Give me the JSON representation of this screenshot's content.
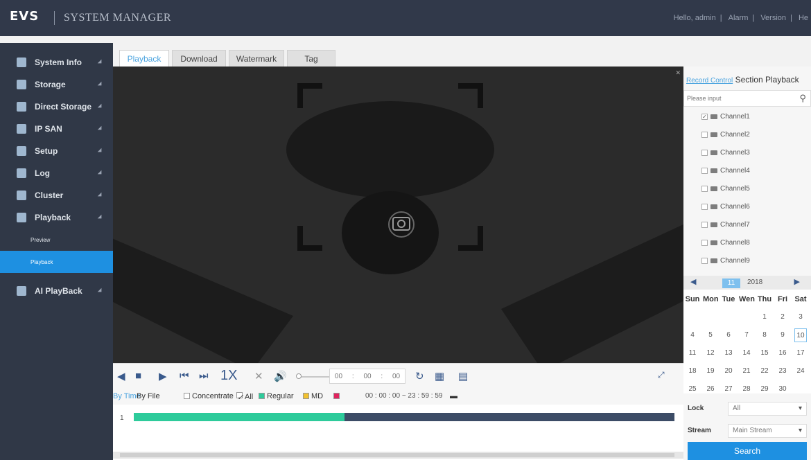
{
  "header": {
    "logo": "EVS",
    "title": "SYSTEM MANAGER",
    "links": [
      "Hello, admin",
      "Alarm",
      "Version",
      "He"
    ]
  },
  "sidebar": {
    "items": [
      {
        "label": "System Info"
      },
      {
        "label": "Storage"
      },
      {
        "label": "Direct Storage"
      },
      {
        "label": "IP SAN"
      },
      {
        "label": "Setup"
      },
      {
        "label": "Log"
      },
      {
        "label": "Cluster"
      },
      {
        "label": "Playback"
      }
    ],
    "sub_items": [
      {
        "label": "Preview"
      },
      {
        "label": "Playback"
      }
    ],
    "last_item": {
      "label": "AI PlayBack"
    }
  },
  "tabs": [
    {
      "label": "Playback"
    },
    {
      "label": "Download"
    },
    {
      "label": "Watermark"
    },
    {
      "label": "Tag"
    }
  ],
  "player": {
    "speed": "1X",
    "time": [
      "00",
      "00",
      "00"
    ]
  },
  "timebar": {
    "by_time": "By Time",
    "by_file": "By File",
    "concentrate": "Concentrate",
    "all": "All",
    "regular": "Regular",
    "md": "MD",
    "range": "00 : 00 : 00  ~  23 : 59 : 59",
    "track_label": "1",
    "recorded_fraction": 0.39
  },
  "right_panel": {
    "tab_record_control": "Record Control",
    "tab_section": "Section Playback",
    "search_placeholder": "Please input",
    "channels": [
      {
        "label": "Channel1",
        "checked": true
      },
      {
        "label": "Channel2"
      },
      {
        "label": "Channel3"
      },
      {
        "label": "Channel4"
      },
      {
        "label": "Channel5"
      },
      {
        "label": "Channel6"
      },
      {
        "label": "Channel7"
      },
      {
        "label": "Channel8"
      },
      {
        "label": "Channel9"
      }
    ],
    "calendar": {
      "month": "11",
      "year": "2018",
      "weekdays": [
        "Sun",
        "Mon",
        "Tue",
        "Wen",
        "Thu",
        "Fri",
        "Sat"
      ],
      "selected": "10"
    },
    "lock_label": "Lock",
    "lock_value": "All",
    "stream_label": "Stream",
    "stream_value": "Main Stream",
    "search_label": "Search"
  }
}
